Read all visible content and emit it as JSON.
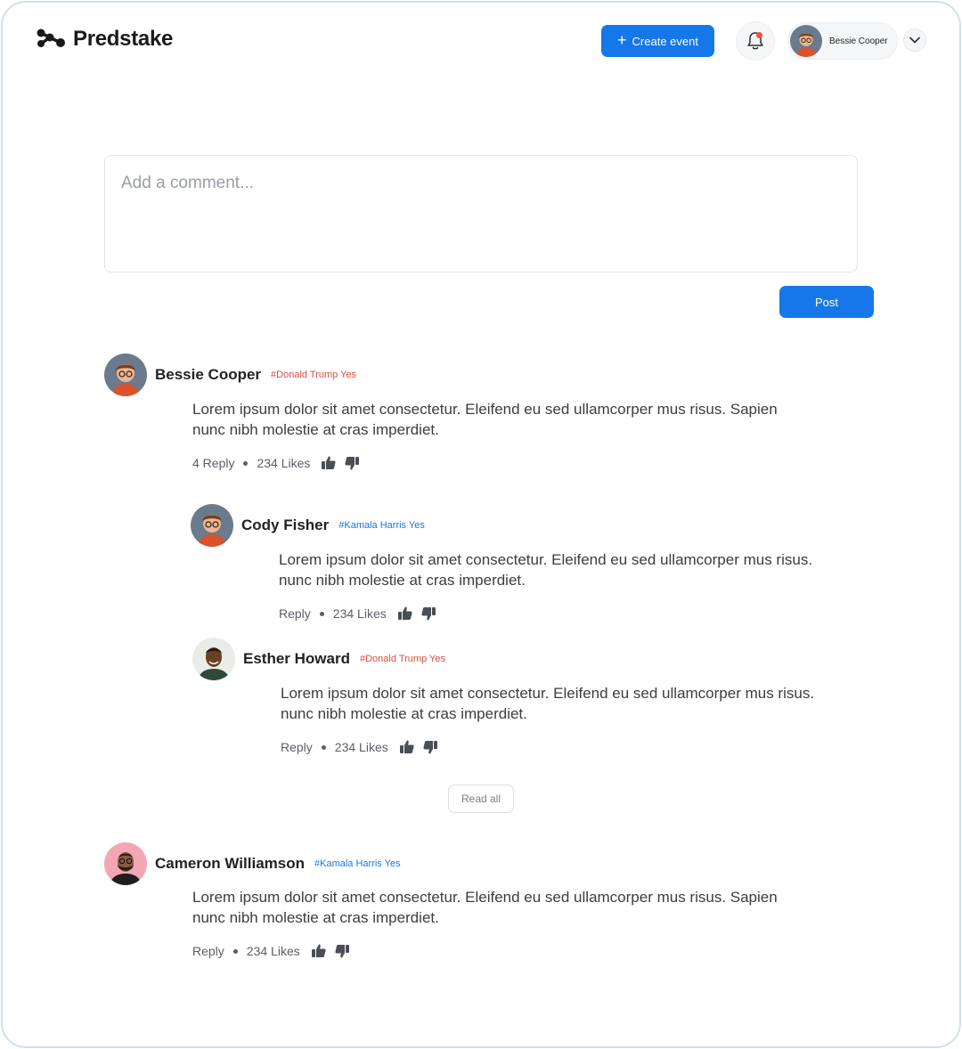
{
  "app": {
    "brand": "Predstake"
  },
  "header": {
    "create_label": "Create event",
    "user_name": "Bessie Cooper"
  },
  "composer": {
    "placeholder": "Add a comment...",
    "post_label": "Post"
  },
  "comments": [
    {
      "name": "Bessie Cooper",
      "tag": "#Donald Trump Yes",
      "line1": "Lorem ipsum dolor sit amet consectetur. Eleifend eu sed ullamcorper mus risus. Sapien",
      "line2": "nunc nibh molestie at cras imperdiet.",
      "reply": "4 Reply",
      "likes": "234 Likes"
    },
    {
      "name": "Cody Fisher",
      "tag": "#Kamala Harris Yes",
      "line1": "Lorem ipsum dolor sit amet consectetur. Eleifend eu sed ullamcorper mus risus.",
      "line2": "nunc nibh molestie at cras imperdiet.",
      "reply": "Reply",
      "likes": "234 Likes"
    },
    {
      "name": "Esther Howard",
      "tag": "#Donald Trump Yes",
      "line1": "Lorem ipsum dolor sit amet consectetur. Eleifend eu sed ullamcorper mus risus.",
      "line2": "nunc nibh molestie at cras imperdiet.",
      "reply": "Reply",
      "likes": "234 Likes"
    },
    {
      "name": "Cameron Williamson",
      "tag": "#Kamala Harris Yes",
      "line1": "Lorem ipsum dolor sit amet consectetur. Eleifend eu sed ullamcorper mus risus. Sapien",
      "line2": "nunc nibh molestie at cras imperdiet.",
      "reply": "Reply",
      "likes": "234 Likes"
    }
  ],
  "read_all_label": "Read all",
  "colors": {
    "accent": "#1677e8",
    "tag_trump": "#e14b3b",
    "tag_harris": "#1677e8"
  },
  "icons": [
    "logo-mark",
    "plus-icon",
    "bell-icon",
    "chevron-down-icon",
    "thumbs-up-icon",
    "thumbs-down-icon"
  ]
}
